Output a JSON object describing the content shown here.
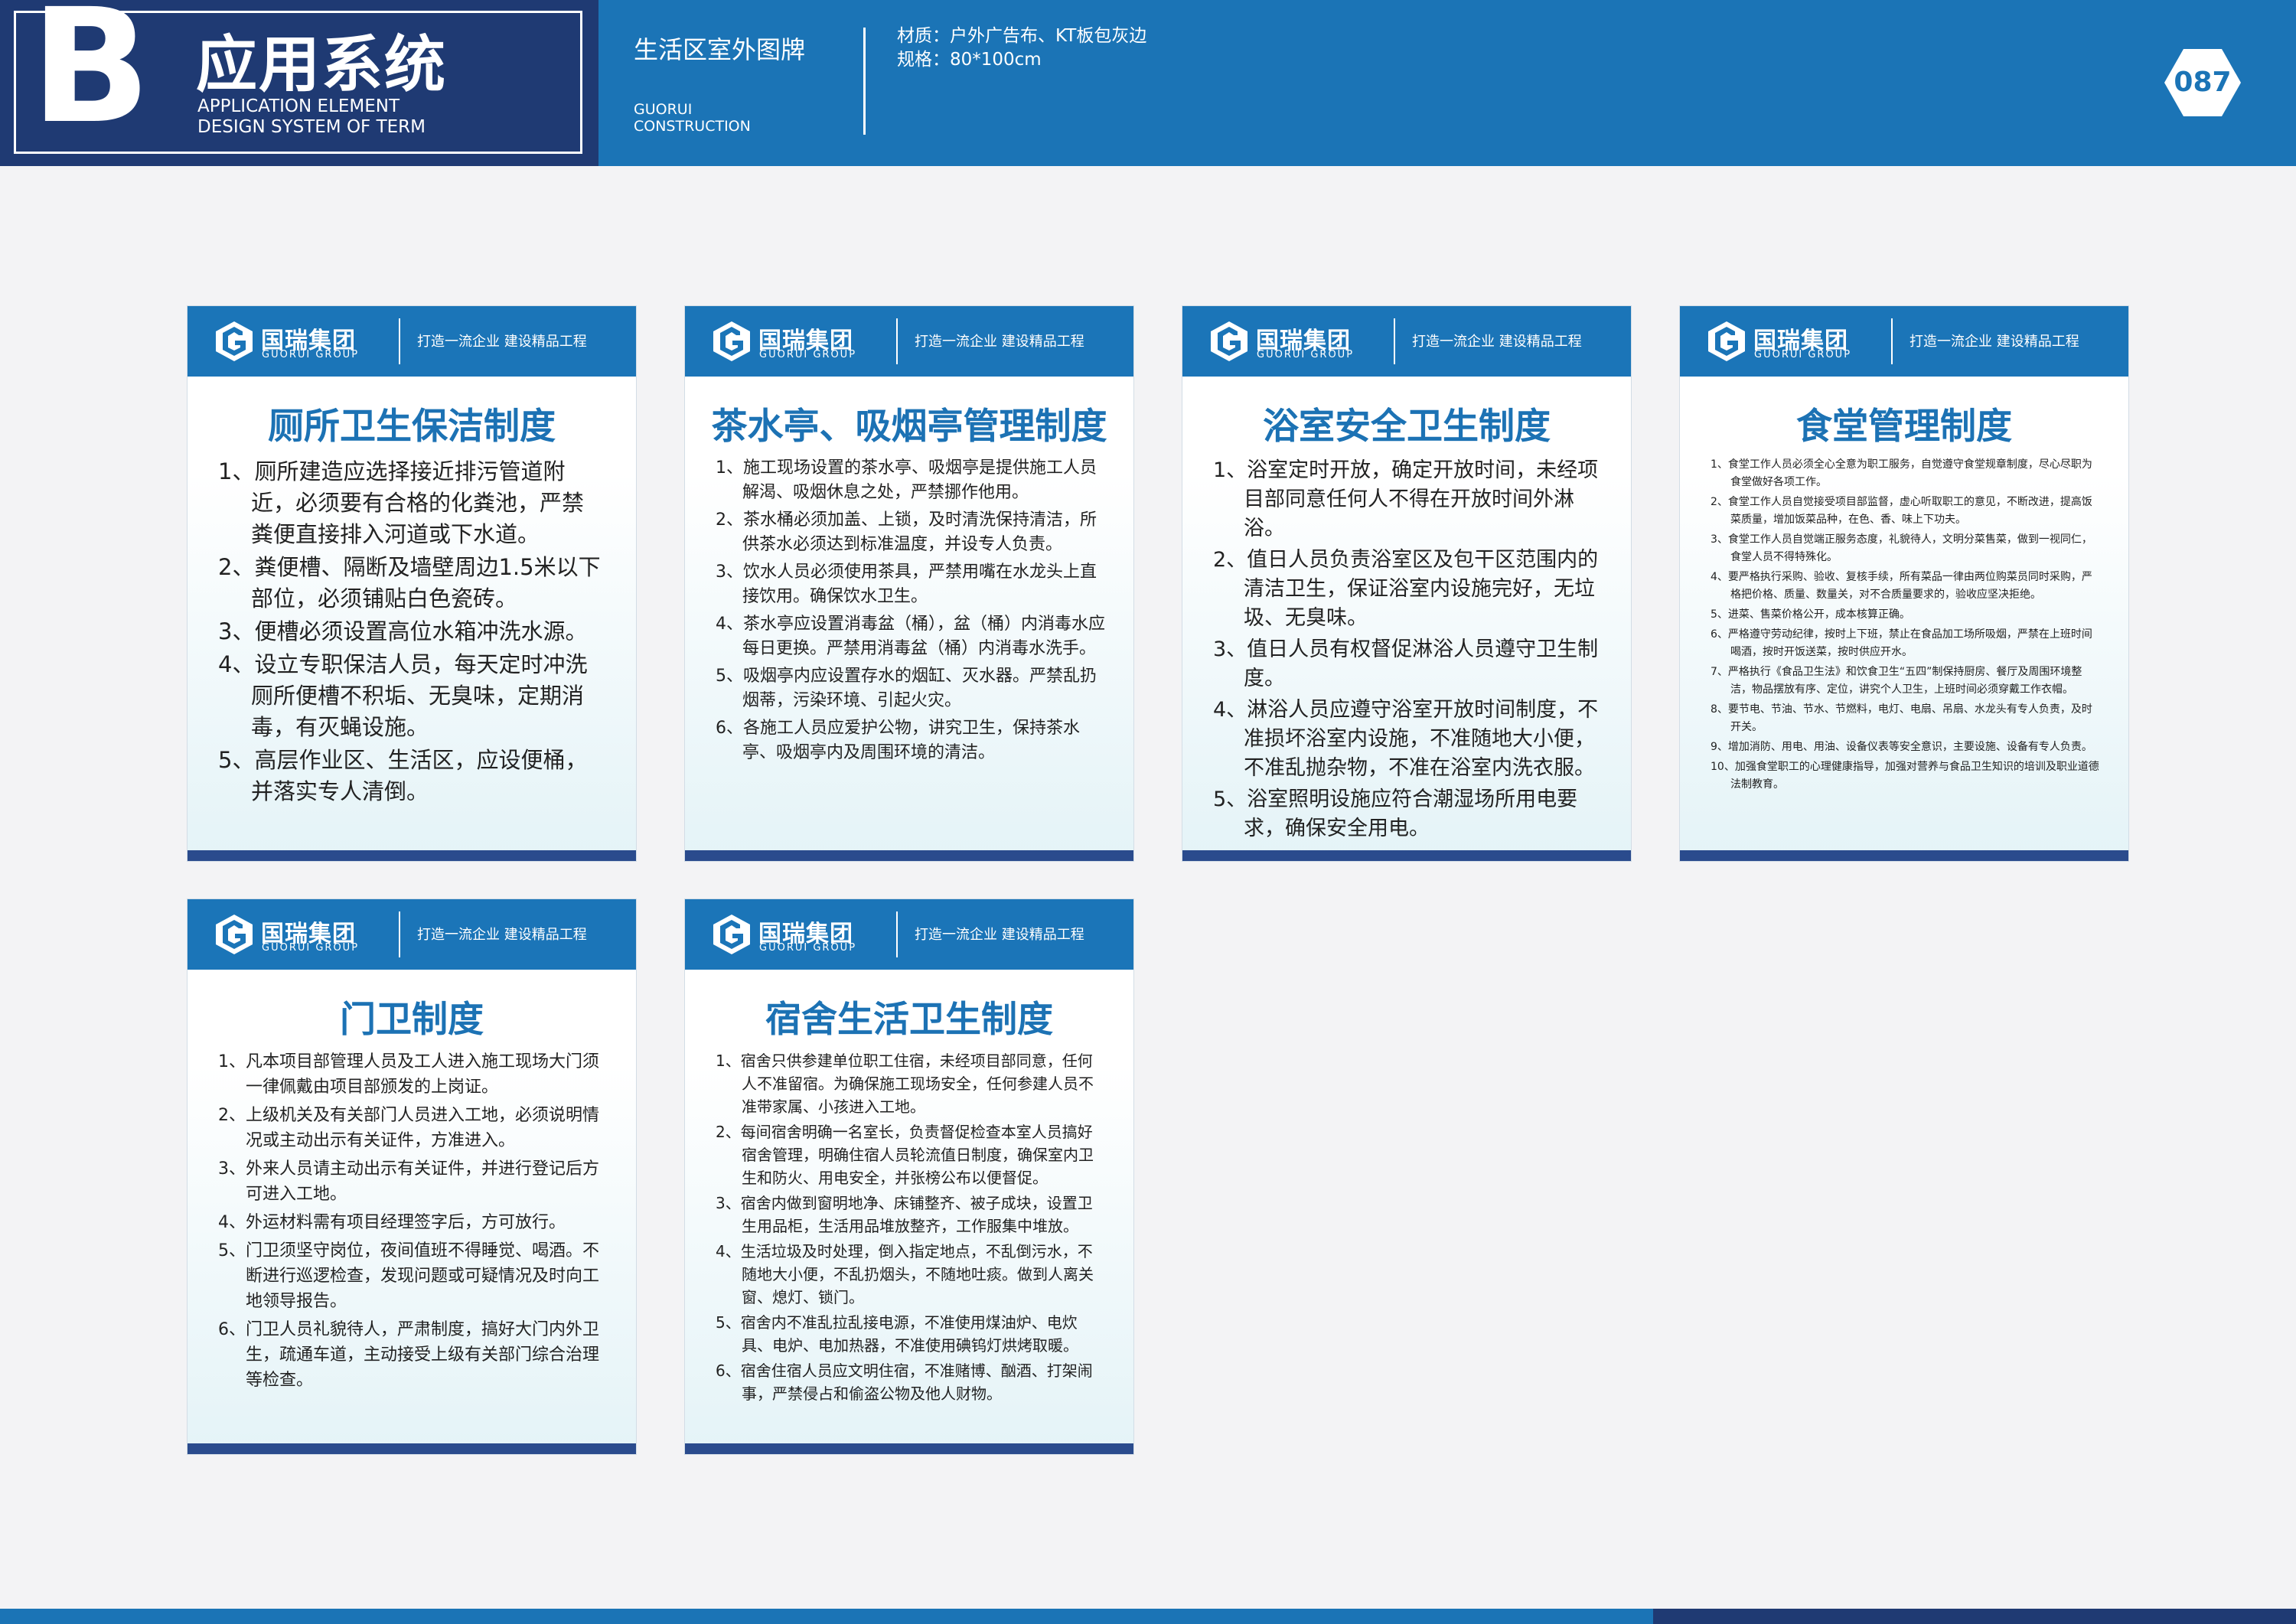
{
  "header": {
    "letter": "B",
    "section_title": "应用系统",
    "section_sub_1": "APPLICATION ELEMENT",
    "section_sub_2": "DESIGN SYSTEM OF TERM",
    "page_title": "生活区室外图牌",
    "page_sub_1": "GUORUI",
    "page_sub_2": "CONSTRUCTION",
    "material": "材质：户外广告布、KT板包灰边",
    "size": "规格：80*100cm",
    "page_number": "087"
  },
  "brand": {
    "name": "国瑞集团",
    "name_en": "GUORUI GROUP",
    "slogan": "打造一流企业  建设精品工程",
    "colors": {
      "primary": "#1b74b6",
      "navy": "#1f3a73"
    }
  },
  "signs": [
    {
      "title": "厕所卫生保洁制度",
      "items": [
        "1、厕所建造应选择接近排污管道附近，必须要有合格的化粪池，严禁粪便直接排入河道或下水道。",
        "2、粪便槽、隔断及墙壁周边1.5米以下部位，必须铺贴白色瓷砖。",
        "3、便槽必须设置高位水箱冲洗水源。",
        "4、设立专职保洁人员，每天定时冲洗厕所便槽不积垢、无臭味，定期消毒，有灭蝇设施。",
        "5、高层作业区、生活区，应设便桶，并落实专人清倒。"
      ]
    },
    {
      "title": "茶水亭、吸烟亭管理制度",
      "items": [
        "1、施工现场设置的茶水亭、吸烟亭是提供施工人员解渴、吸烟休息之处，严禁挪作他用。",
        "2、茶水桶必须加盖、上锁，及时清洗保持清洁，所供茶水必须达到标准温度，并设专人负责。",
        "3、饮水人员必须使用茶具，严禁用嘴在水龙头上直接饮用。确保饮水卫生。",
        "4、茶水亭应设置消毒盆（桶），盆（桶）内消毒水应每日更换。严禁用消毒盆（桶）内消毒水洗手。",
        "5、吸烟亭内应设置存水的烟缸、灭水器。严禁乱扔烟蒂，污染环境、引起火灾。",
        "6、各施工人员应爱护公物，讲究卫生，保持茶水亭、吸烟亭内及周围环境的清洁。"
      ]
    },
    {
      "title": "浴室安全卫生制度",
      "items": [
        "1、浴室定时开放，确定开放时间，未经项目部同意任何人不得在开放时间外淋浴。",
        "2、值日人员负责浴室区及包干区范围内的清洁卫生，保证浴室内设施完好，无垃圾、无臭味。",
        "3、值日人员有权督促淋浴人员遵守卫生制度。",
        "4、淋浴人员应遵守浴室开放时间制度，不准损坏浴室内设施，不准随地大小便，不准乱抛杂物，不准在浴室内洗衣服。",
        "5、浴室照明设施应符合潮湿场所用电要求，确保安全用电。"
      ]
    },
    {
      "title": "食堂管理制度",
      "items": [
        "1、食堂工作人员必须全心全意为职工服务，自觉遵守食堂规章制度，尽心尽职为食堂做好各项工作。",
        "2、食堂工作人员自觉接受项目部监督，虚心听取职工的意见，不断改进，提高饭菜质量，增加饭菜品种，在色、香、味上下功夫。",
        "3、食堂工作人员自觉端正服务态度，礼貌待人，文明分菜售菜，做到一视同仁，食堂人员不得特殊化。",
        "4、要严格执行采购、验收、复核手续，所有菜品一律由两位购菜员同时采购，严格把价格、质量、数量关，对不合质量要求的，验收应坚决拒绝。",
        "5、进菜、售菜价格公开，成本核算正确。",
        "6、严格遵守劳动纪律，按时上下班，禁止在食品加工场所吸烟，严禁在上班时间喝酒，按时开饭送菜，按时供应开水。",
        "7、严格执行《食品卫生法》和饮食卫生“五四”制保持厨房、餐厅及周围环境整洁，物品摆放有序、定位，讲究个人卫生，上班时间必须穿戴工作衣帽。",
        "8、要节电、节油、节水、节燃料，电灯、电扇、吊扇、水龙头有专人负责，及时开关。",
        "9、增加消防、用电、用油、设备仪表等安全意识，主要设施、设备有专人负责。",
        "10、加强食堂职工的心理健康指导，加强对营养与食品卫生知识的培训及职业道德法制教育。"
      ]
    },
    {
      "title": "门卫制度",
      "items": [
        "1、凡本项目部管理人员及工人进入施工现场大门须一律佩戴由项目部颁发的上岗证。",
        "2、上级机关及有关部门人员进入工地，必须说明情况或主动出示有关证件，方准进入。",
        "3、外来人员请主动出示有关证件，并进行登记后方可进入工地。",
        "4、外运材料需有项目经理签字后，方可放行。",
        "5、门卫须坚守岗位，夜间值班不得睡觉、喝酒。不断进行巡逻检查，发现问题或可疑情况及时向工地领导报告。",
        "6、门卫人员礼貌待人，严肃制度，搞好大门内外卫生，疏通车道，主动接受上级有关部门综合治理等检查。"
      ]
    },
    {
      "title": "宿舍生活卫生制度",
      "items": [
        "1、宿舍只供参建单位职工住宿，未经项目部同意，任何人不准留宿。为确保施工现场安全，任何参建人员不准带家属、小孩进入工地。",
        "2、每间宿舍明确一名室长，负责督促检查本室人员搞好宿舍管理，明确住宿人员轮流值日制度，确保室内卫生和防火、用电安全，并张榜公布以便督促。",
        "3、宿舍内做到窗明地净、床铺整齐、被子成块，设置卫生用品柜，生活用品堆放整齐，工作服集中堆放。",
        "4、生活垃圾及时处理，倒入指定地点，不乱倒污水，不随地大小便，不乱扔烟头，不随地吐痰。做到人离关窗、熄灯、锁门。",
        "5、宿舍内不准乱拉乱接电源，不准使用煤油炉、电炊具、电炉、电加热器，不准使用碘钨灯烘烤取暖。",
        "6、宿舍住宿人员应文明住宿，不准赌博、酗酒、打架闹事，严禁侵占和偷盗公物及他人财物。"
      ]
    }
  ]
}
